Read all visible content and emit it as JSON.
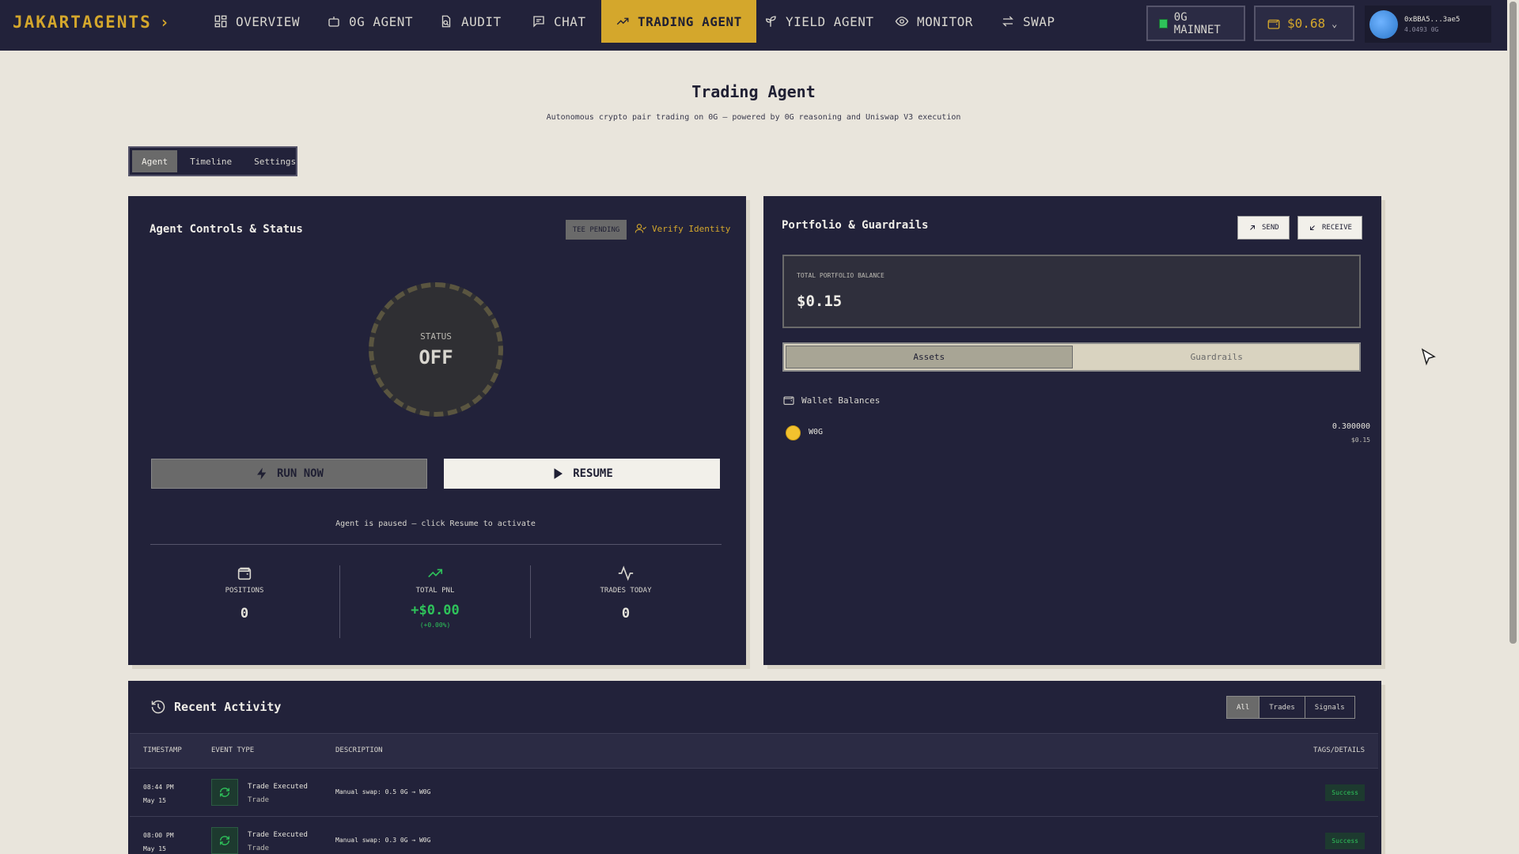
{
  "brand": "JAKARTAGENTS",
  "nav": [
    {
      "label": "OVERVIEW",
      "icon": "grid-icon"
    },
    {
      "label": "0G AGENT",
      "icon": "robot-icon"
    },
    {
      "label": "AUDIT",
      "icon": "file-search-icon"
    },
    {
      "label": "CHAT",
      "icon": "chat-icon"
    },
    {
      "label": "TRADING AGENT",
      "icon": "trending-up-icon",
      "active": true
    },
    {
      "label": "YIELD AGENT",
      "icon": "sprout-icon"
    },
    {
      "label": "MONITOR",
      "icon": "eye-icon"
    },
    {
      "label": "SWAP",
      "icon": "swap-icon"
    }
  ],
  "network": {
    "label": "0G MAINNET",
    "status_color": "#2ec25a"
  },
  "balance": {
    "value": "$0.68"
  },
  "account": {
    "address": "0xBBA5...3ae5",
    "amount": "4.0493 0G"
  },
  "page": {
    "title": "Trading Agent",
    "subtitle": "Autonomous crypto pair trading on 0G — powered by 0G reasoning and Uniswap V3 execution"
  },
  "tabs": [
    "Agent",
    "Timeline",
    "Settings"
  ],
  "controls": {
    "title": "Agent Controls & Status",
    "tee_badge": "TEE PENDING",
    "verify": "Verify Identity",
    "status_label": "STATUS",
    "status_value": "OFF",
    "run_now": "RUN NOW",
    "resume": "RESUME",
    "paused_msg": "Agent is paused — click Resume to activate",
    "stats": [
      {
        "label": "POSITIONS",
        "value": "0"
      },
      {
        "label": "TOTAL PNL",
        "value": "+$0.00",
        "sub": "(+0.00%)"
      },
      {
        "label": "TRADES TODAY",
        "value": "0"
      }
    ]
  },
  "portfolio": {
    "title": "Portfolio & Guardrails",
    "send": "SEND",
    "receive": "RECEIVE",
    "total_label": "TOTAL PORTFOLIO BALANCE",
    "total_value": "$0.15",
    "segments": [
      "Assets",
      "Guardrails"
    ],
    "wallet_label": "Wallet Balances",
    "assets": [
      {
        "symbol": "W0G",
        "amount": "0.300000",
        "usd": "$0.15"
      }
    ]
  },
  "activity": {
    "title": "Recent Activity",
    "filters": [
      "All",
      "Trades",
      "Signals"
    ],
    "columns": [
      "TIMESTAMP",
      "EVENT TYPE",
      "DESCRIPTION",
      "TAGS/DETAILS"
    ],
    "rows": [
      {
        "time": "08:44 PM",
        "date": "May 15",
        "event": "Trade Executed",
        "type": "Trade",
        "desc": "Manual swap: 0.5 0G → W0G",
        "tag": "Success"
      },
      {
        "time": "08:00 PM",
        "date": "May 15",
        "event": "Trade Executed",
        "type": "Trade",
        "desc": "Manual swap: 0.3 0G → W0G",
        "tag": "Success"
      }
    ]
  }
}
